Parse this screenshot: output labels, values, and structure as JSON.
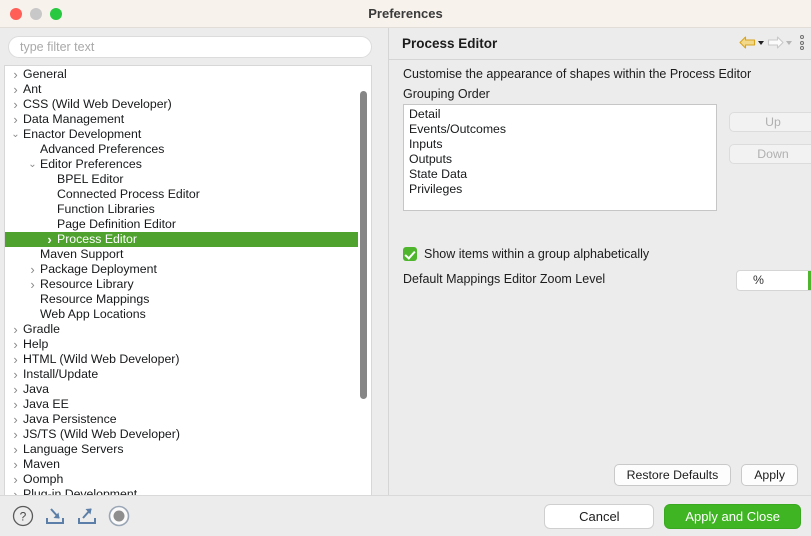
{
  "window": {
    "title": "Preferences",
    "traffic_lights": [
      "close",
      "minimize",
      "zoom"
    ]
  },
  "sidebar": {
    "filter": {
      "value": "",
      "placeholder": "type filter text"
    },
    "tree": [
      {
        "label": "General",
        "indent": 0,
        "state": "collapsed"
      },
      {
        "label": "Ant",
        "indent": 0,
        "state": "collapsed"
      },
      {
        "label": "CSS (Wild Web Developer)",
        "indent": 0,
        "state": "collapsed"
      },
      {
        "label": "Data Management",
        "indent": 0,
        "state": "collapsed"
      },
      {
        "label": "Enactor Development",
        "indent": 0,
        "state": "expanded"
      },
      {
        "label": "Advanced Preferences",
        "indent": 1,
        "state": "leaf"
      },
      {
        "label": "Editor Preferences",
        "indent": 1,
        "state": "expanded"
      },
      {
        "label": "BPEL Editor",
        "indent": 2,
        "state": "leaf"
      },
      {
        "label": "Connected Process Editor",
        "indent": 2,
        "state": "leaf"
      },
      {
        "label": "Function Libraries",
        "indent": 2,
        "state": "leaf"
      },
      {
        "label": "Page Definition Editor",
        "indent": 2,
        "state": "leaf"
      },
      {
        "label": "Process Editor",
        "indent": 2,
        "state": "collapsed",
        "selected": true
      },
      {
        "label": "Maven Support",
        "indent": 1,
        "state": "leaf"
      },
      {
        "label": "Package Deployment",
        "indent": 1,
        "state": "collapsed"
      },
      {
        "label": "Resource Library",
        "indent": 1,
        "state": "collapsed"
      },
      {
        "label": "Resource Mappings",
        "indent": 1,
        "state": "leaf"
      },
      {
        "label": "Web App Locations",
        "indent": 1,
        "state": "leaf"
      },
      {
        "label": "Gradle",
        "indent": 0,
        "state": "collapsed"
      },
      {
        "label": "Help",
        "indent": 0,
        "state": "collapsed"
      },
      {
        "label": "HTML (Wild Web Developer)",
        "indent": 0,
        "state": "collapsed"
      },
      {
        "label": "Install/Update",
        "indent": 0,
        "state": "collapsed"
      },
      {
        "label": "Java",
        "indent": 0,
        "state": "collapsed"
      },
      {
        "label": "Java EE",
        "indent": 0,
        "state": "collapsed"
      },
      {
        "label": "Java Persistence",
        "indent": 0,
        "state": "collapsed"
      },
      {
        "label": "JS/TS (Wild Web Developer)",
        "indent": 0,
        "state": "collapsed"
      },
      {
        "label": "Language Servers",
        "indent": 0,
        "state": "collapsed"
      },
      {
        "label": "Maven",
        "indent": 0,
        "state": "collapsed"
      },
      {
        "label": "Oomph",
        "indent": 0,
        "state": "collapsed"
      },
      {
        "label": "Plug-in Development",
        "indent": 0,
        "state": "collapsed"
      }
    ]
  },
  "detail": {
    "title": "Process Editor",
    "nav": {
      "back_icon": "back-arrow-icon",
      "back_enabled": true,
      "forward_icon": "forward-arrow-icon",
      "forward_enabled": false,
      "menu_icon": "view-menu-icon"
    },
    "description": "Customise the appearance of shapes within the Process Editor",
    "group_order_label": "Grouping Order",
    "group_order_items": [
      "Detail",
      "Events/Outcomes",
      "Inputs",
      "Outputs",
      "State Data",
      "Privileges"
    ],
    "list_buttons": [
      {
        "label": "Up",
        "enabled": false
      },
      {
        "label": "Down",
        "enabled": false
      }
    ],
    "alphabetical_checkbox": {
      "label": "Show items within a group alphabetically",
      "checked": true
    },
    "zoom_level": {
      "label": "Default Mappings Editor Zoom Level",
      "value": "%"
    },
    "actions": {
      "restore_defaults": "Restore Defaults",
      "apply": "Apply"
    }
  },
  "footer": {
    "icons": [
      "help-icon",
      "import-preferences-icon",
      "export-preferences-icon",
      "record-icon"
    ],
    "cancel": "Cancel",
    "apply_and_close": "Apply and Close"
  },
  "colors": {
    "selection_green": "#4fa22d",
    "accent_green": "#3fb523",
    "back_arrow_gold": "#e0a91b"
  }
}
